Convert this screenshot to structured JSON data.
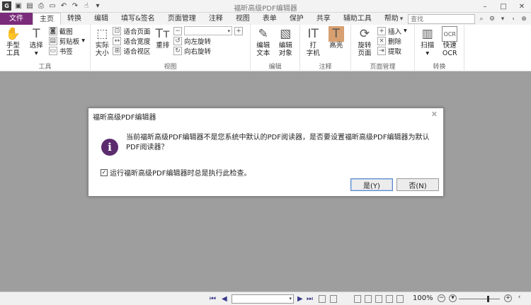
{
  "window": {
    "title": "福昕高级PDF编辑器",
    "controls": [
      "–",
      "□",
      "✕"
    ]
  },
  "quick_access": [
    "save-icon",
    "open-icon",
    "print-icon",
    "new-icon",
    "undo-icon",
    "redo-icon",
    "hand-icon"
  ],
  "tabs": [
    "文件",
    "主页",
    "转换",
    "编辑",
    "填写&签名",
    "页面管理",
    "注释",
    "视图",
    "表单",
    "保护",
    "共享",
    "辅助工具",
    "帮助"
  ],
  "search": {
    "placeholder": "查找"
  },
  "ribbon": {
    "tools": {
      "label": "工具",
      "hand": "手型\n工具",
      "select": "选择",
      "screenshot": "截图",
      "clipboard": "剪贴板",
      "bookmark": "书签"
    },
    "view": {
      "label": "视图",
      "actual": "实际\n大小",
      "fit_page": "适合页面",
      "fit_width": "适合宽度",
      "fit_visible": "适合视区",
      "reflow": "重排",
      "rotate_left": "向左旋转",
      "rotate_right": "向右旋转"
    },
    "edit": {
      "label": "编辑",
      "edit_text": "编辑\n文本",
      "edit_object": "编辑\n对象"
    },
    "comment": {
      "label": "注释",
      "typewriter": "打\n字机",
      "highlight": "高亮"
    },
    "pages": {
      "label": "页面管理",
      "rotate": "旋转\n页面",
      "insert": "插入",
      "delete": "删除",
      "extract": "提取"
    },
    "convert": {
      "label": "转换",
      "scan": "扫描",
      "ocr": "快速\nOCR"
    }
  },
  "dialog": {
    "title": "福昕高级PDF编辑器",
    "message": "当前福昕高级PDF编辑器不是您系统中默认的PDF阅读器，是否要设置福昕高级PDF编辑器为默认PDF阅读器？",
    "checkbox_label": "运行福昕高级PDF编辑器时总是执行此检查。",
    "checkbox_checked": true,
    "yes": "是(Y)",
    "no": "否(N)"
  },
  "status": {
    "zoom": "100%",
    "zoom_fraction": 0.7
  }
}
